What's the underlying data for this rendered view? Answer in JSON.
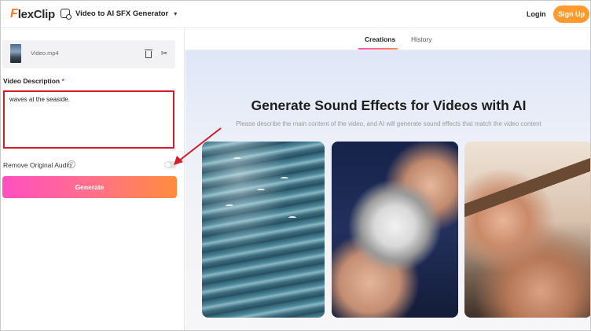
{
  "header": {
    "logo_f": "F",
    "logo_rest": "lexClip",
    "tool_name": "Video to AI SFX Generator",
    "login_label": "Login",
    "signup_label": "Sign Up"
  },
  "left_panel": {
    "file_name": "Video.mp4",
    "description_label": "Video Description",
    "required_mark": "*",
    "description_value": "waves at the seaside.",
    "remove_audio_label": "Remove Original Audio",
    "help_glyph": "?",
    "remove_audio_enabled": false,
    "generate_label": "Generate"
  },
  "right_panel": {
    "tabs": [
      {
        "label": "Creations",
        "active": true
      },
      {
        "label": "History",
        "active": false
      }
    ],
    "hero_title": "Generate Sound Effects for Videos with AI",
    "hero_subtitle": "Please describe the main content of the video, and AI will generate sound effects that match the video content"
  },
  "colors": {
    "accent_orange": "#ff9a2e",
    "highlight_red": "#d21e2b",
    "generate_gradient_start": "#ff4fc1",
    "generate_gradient_end": "#ff8d3c"
  },
  "icons": [
    "video-tool-icon",
    "chevron-down-icon",
    "trash-icon",
    "scissors-icon",
    "help-icon",
    "annotation-arrow-icon"
  ]
}
